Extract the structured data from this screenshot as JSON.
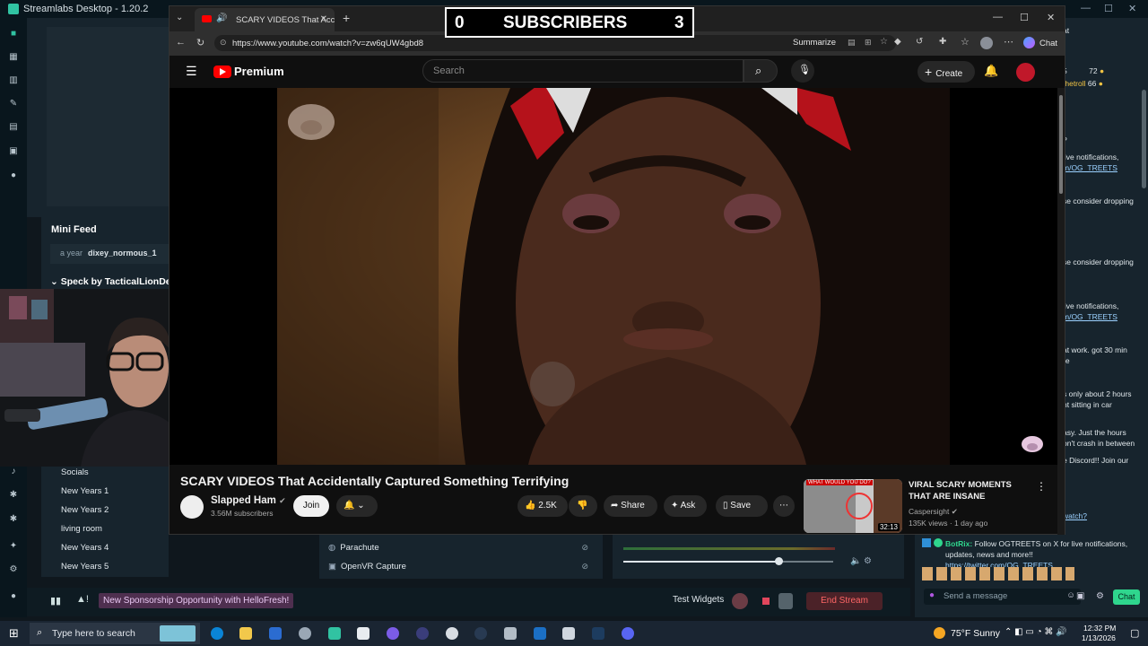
{
  "streamlabs": {
    "title": "Streamlabs Desktop - 1.20.2",
    "mini_feed": {
      "title": "Mini Feed",
      "item_age": "a year",
      "item_user": "dixey_normous_1"
    },
    "speck_title": "Speck by TacticalLionDes",
    "scenes": [
      "Socials",
      "New Years 1",
      "New Years 2",
      "living room",
      "New Years 4",
      "New Years 5"
    ],
    "sources": [
      "Parachute",
      "OpenVR Capture"
    ],
    "sponsorship": "New Sponsorship Opportunity with HelloFresh!",
    "test_widgets": "Test Widgets",
    "end_stream": "End Stream",
    "chat_input_placeholder": "Send a message",
    "chat_button": "Chat",
    "chat_right_label": "at",
    "chat_lines": [
      {
        "text": "5",
        "extra": "72",
        "user": ""
      },
      {
        "text": "thetroll",
        "extra": "66",
        "user": ""
      },
      {
        "text": "?",
        "extra": "",
        "user": ""
      },
      {
        "text": "live notifications,",
        "extra": "",
        "user": ""
      },
      {
        "text": "m/OG_TREETS",
        "extra": "",
        "user": "link"
      },
      {
        "text": "se consider dropping",
        "extra": "",
        "user": ""
      },
      {
        "text": "se consider dropping",
        "extra": "",
        "user": ""
      },
      {
        "text": "live notifications,",
        "extra": "",
        "user": ""
      },
      {
        "text": "m/OG_TREETS",
        "extra": "",
        "user": "link"
      },
      {
        "text": "at work. got 30 min",
        "extra": "",
        "user": ""
      },
      {
        "text": "re",
        "extra": "",
        "user": ""
      },
      {
        "text": "s only about 2 hours",
        "extra": "",
        "user": ""
      },
      {
        "text": "nt sitting in car",
        "extra": "",
        "user": ""
      },
      {
        "text": "asy. Just the hours",
        "extra": "",
        "user": ""
      },
      {
        "text": "on't crash in between",
        "extra": "",
        "user": ""
      },
      {
        "text": "e Discord!! Join our",
        "extra": "",
        "user": ""
      },
      {
        "text": "watch?",
        "extra": "",
        "user": "link"
      }
    ],
    "botrix": {
      "name": "BotRix:",
      "message": "Follow OGTREETS on X for live notifications, updates, news and more!!",
      "link": "https://twitter.com/OG_TREETS"
    }
  },
  "browser": {
    "tab_title": "SCARY VIDEOS That Accidenta",
    "url": "https://www.youtube.com/watch?v=zw6qUW4gbd8",
    "summarize": "Summarize",
    "copilot_chat": "Chat"
  },
  "youtube": {
    "brand": "Premium",
    "search_placeholder": "Search",
    "create": "Create",
    "video_title": "SCARY VIDEOS That Accidentally Captured Something Terrifying",
    "channel_name": "Slapped Ham",
    "subscribers": "3.56M subscribers",
    "join": "Join",
    "likes": "2.5K",
    "share": "Share",
    "ask": "Ask",
    "save": "Save",
    "rec_title": "VIRAL SCARY MOMENTS THAT ARE INSANE",
    "rec_channel": "Caspersight",
    "rec_meta": "135K views · 1 day ago",
    "rec_duration": "32:13",
    "rec_thumb_text": "WHAT WOULD YOU DO?"
  },
  "overlay": {
    "left_count": "0",
    "label": "SUBSCRIBERS",
    "right_count": "3"
  },
  "taskbar": {
    "search_placeholder": "Type here to search",
    "weather": "75°F  Sunny",
    "time": "12:32 PM",
    "date": "1/13/2026"
  },
  "colors": {
    "streamlabs_bg": "#17242d",
    "streamlabs_accent": "#31c3a2",
    "youtube_red": "#ff0000",
    "end_stream": "#4b2228"
  }
}
